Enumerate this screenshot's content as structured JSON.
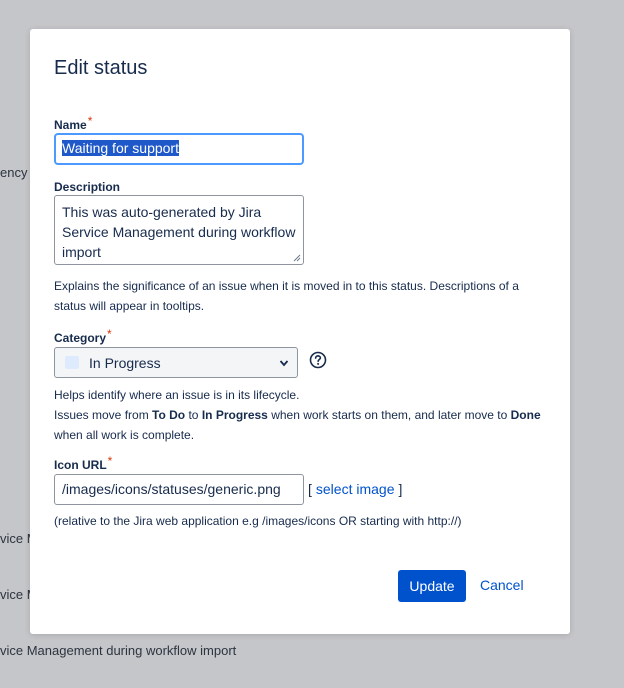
{
  "background": {
    "text_1": "ency",
    "text_2": "vice M",
    "text_3": "vice M",
    "text_4": "vice Management during workflow import"
  },
  "dialog": {
    "title": "Edit status",
    "name": {
      "label": "Name",
      "required_marker": "*",
      "value": "Waiting for support"
    },
    "description": {
      "label": "Description",
      "value": "This was auto-generated by Jira Service Management during workflow import",
      "help": "Explains the significance of an issue when it is moved in to this status. Descriptions of a status will appear in tooltips."
    },
    "category": {
      "label": "Category",
      "required_marker": "*",
      "selected": "In Progress",
      "swatch_color": "#deebff",
      "help_line1": "Helps identify where an issue is in its lifecycle.",
      "help_line2_a": "Issues move from ",
      "help_line2_b": "To Do",
      "help_line2_c": " to ",
      "help_line2_d": "In Progress",
      "help_line2_e": " when work starts on them, and later move to ",
      "help_line2_f": "Done",
      "help_line3": "when all work is complete.",
      "help_icon": "question-circle-icon"
    },
    "icon_url": {
      "label": "Icon URL",
      "required_marker": "*",
      "value": "/images/icons/statuses/generic.png",
      "bracket_open": "[",
      "select_image": "select image",
      "bracket_close": "]",
      "help": "(relative to the Jira web application e.g /images/icons OR starting with http://)"
    },
    "buttons": {
      "update": "Update",
      "cancel": "Cancel"
    }
  },
  "colors": {
    "primary": "#0052cc",
    "focus": "#4c9aff",
    "required": "#de350b",
    "overlay": "#c5c6c9"
  }
}
